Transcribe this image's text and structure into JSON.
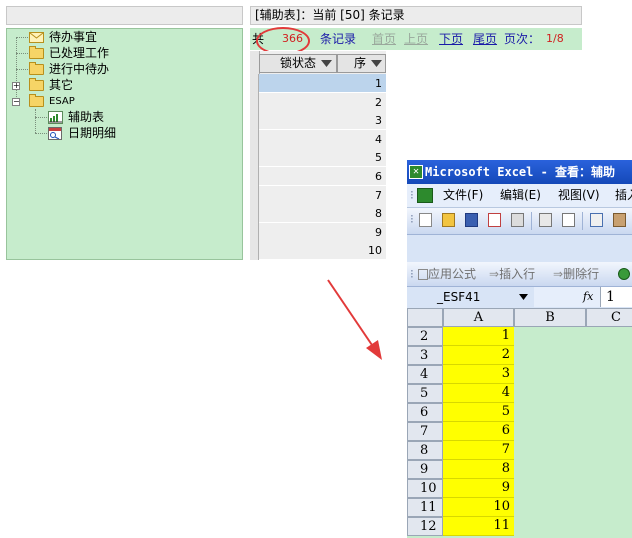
{
  "left_panel": {
    "tree": [
      {
        "label": "待办事宜",
        "icon": "mail-icon"
      },
      {
        "label": "已处理工作",
        "icon": "folder-icon"
      },
      {
        "label": "进行中待办",
        "icon": "folder-icon"
      },
      {
        "label": "其它",
        "icon": "folder-icon",
        "toggle": "+"
      },
      {
        "label": "ESAP",
        "icon": "folder-icon",
        "toggle": "−"
      },
      {
        "label": "辅助表",
        "icon": "spreadsheet-icon"
      },
      {
        "label": "日期明细",
        "icon": "calendar-icon"
      }
    ]
  },
  "main": {
    "title": "[辅助表]：当前 [50] 条记录",
    "pager": {
      "prefix": "共",
      "total": "366",
      "suffix": "条记录",
      "first": "首页",
      "prev": "上页",
      "next": "下页",
      "last": "尾页",
      "page_label": "页次：",
      "page_value": "1/8"
    },
    "grid": {
      "columns": [
        "锁状态",
        "序"
      ],
      "rows": [
        "1",
        "2",
        "3",
        "4",
        "5",
        "6",
        "7",
        "8",
        "9",
        "10"
      ]
    }
  },
  "excel": {
    "title": "Microsoft Excel - 查看：辅助",
    "menu": [
      "文件(F)",
      "编辑(E)",
      "视图(V)",
      "插入"
    ],
    "toolbar2": [
      "应用公式",
      "插入行",
      "删除行"
    ],
    "name_box": "_ESF41",
    "fx": "fx",
    "formula_value": "1",
    "columns": [
      "A",
      "B",
      "C"
    ],
    "rows": [
      {
        "row": "2",
        "a": "1"
      },
      {
        "row": "3",
        "a": "2"
      },
      {
        "row": "4",
        "a": "3"
      },
      {
        "row": "5",
        "a": "4"
      },
      {
        "row": "6",
        "a": "5"
      },
      {
        "row": "7",
        "a": "6"
      },
      {
        "row": "8",
        "a": "7"
      },
      {
        "row": "9",
        "a": "8"
      },
      {
        "row": "10",
        "a": "9"
      },
      {
        "row": "11",
        "a": "10"
      },
      {
        "row": "12",
        "a": "11"
      }
    ]
  },
  "colors": {
    "panel_green": "#c6eccc",
    "highlight_red": "#e23a3a",
    "excel_title_blue": "#1448b8",
    "cell_yellow": "#ffff00"
  }
}
